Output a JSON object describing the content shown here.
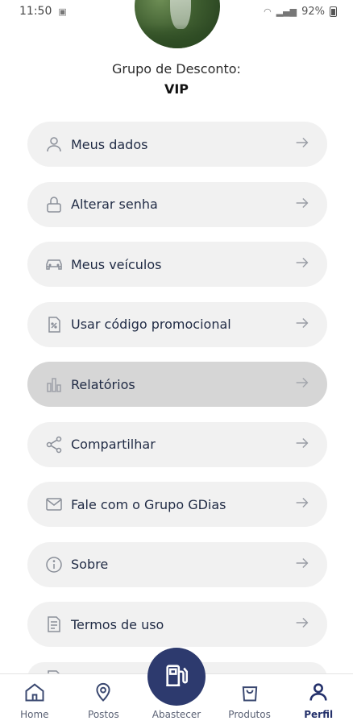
{
  "status_bar": {
    "time": "11:50",
    "battery": "92%"
  },
  "profile": {
    "group_label": "Grupo de Desconto:",
    "group_value": "VIP"
  },
  "menu": {
    "items": [
      {
        "label": "Meus dados",
        "icon": "user-icon"
      },
      {
        "label": "Alterar senha",
        "icon": "lock-icon"
      },
      {
        "label": "Meus veículos",
        "icon": "car-icon"
      },
      {
        "label": "Usar código promocional",
        "icon": "percent-tag-icon"
      },
      {
        "label": "Relatórios",
        "icon": "bar-chart-icon",
        "state": "pressed"
      },
      {
        "label": "Compartilhar",
        "icon": "share-icon"
      },
      {
        "label": "Fale com o Grupo GDias",
        "icon": "mail-icon"
      },
      {
        "label": "Sobre",
        "icon": "info-icon"
      },
      {
        "label": "Termos de uso",
        "icon": "document-icon"
      },
      {
        "label": "",
        "icon": "document-icon"
      }
    ]
  },
  "bottom_nav": {
    "items": [
      {
        "label": "Home",
        "icon": "home-icon"
      },
      {
        "label": "Postos",
        "icon": "map-pin-icon"
      },
      {
        "label": "Abastecer",
        "icon": "fuel-pump-icon"
      },
      {
        "label": "Produtos",
        "icon": "shopping-bag-icon"
      },
      {
        "label": "Perfil",
        "icon": "user-icon",
        "active": true
      }
    ]
  },
  "colors": {
    "primary": "#2d3a6e",
    "item_bg": "#f1f1f1",
    "item_pressed_bg": "#d6d6d6",
    "text": "#1f2a44"
  }
}
